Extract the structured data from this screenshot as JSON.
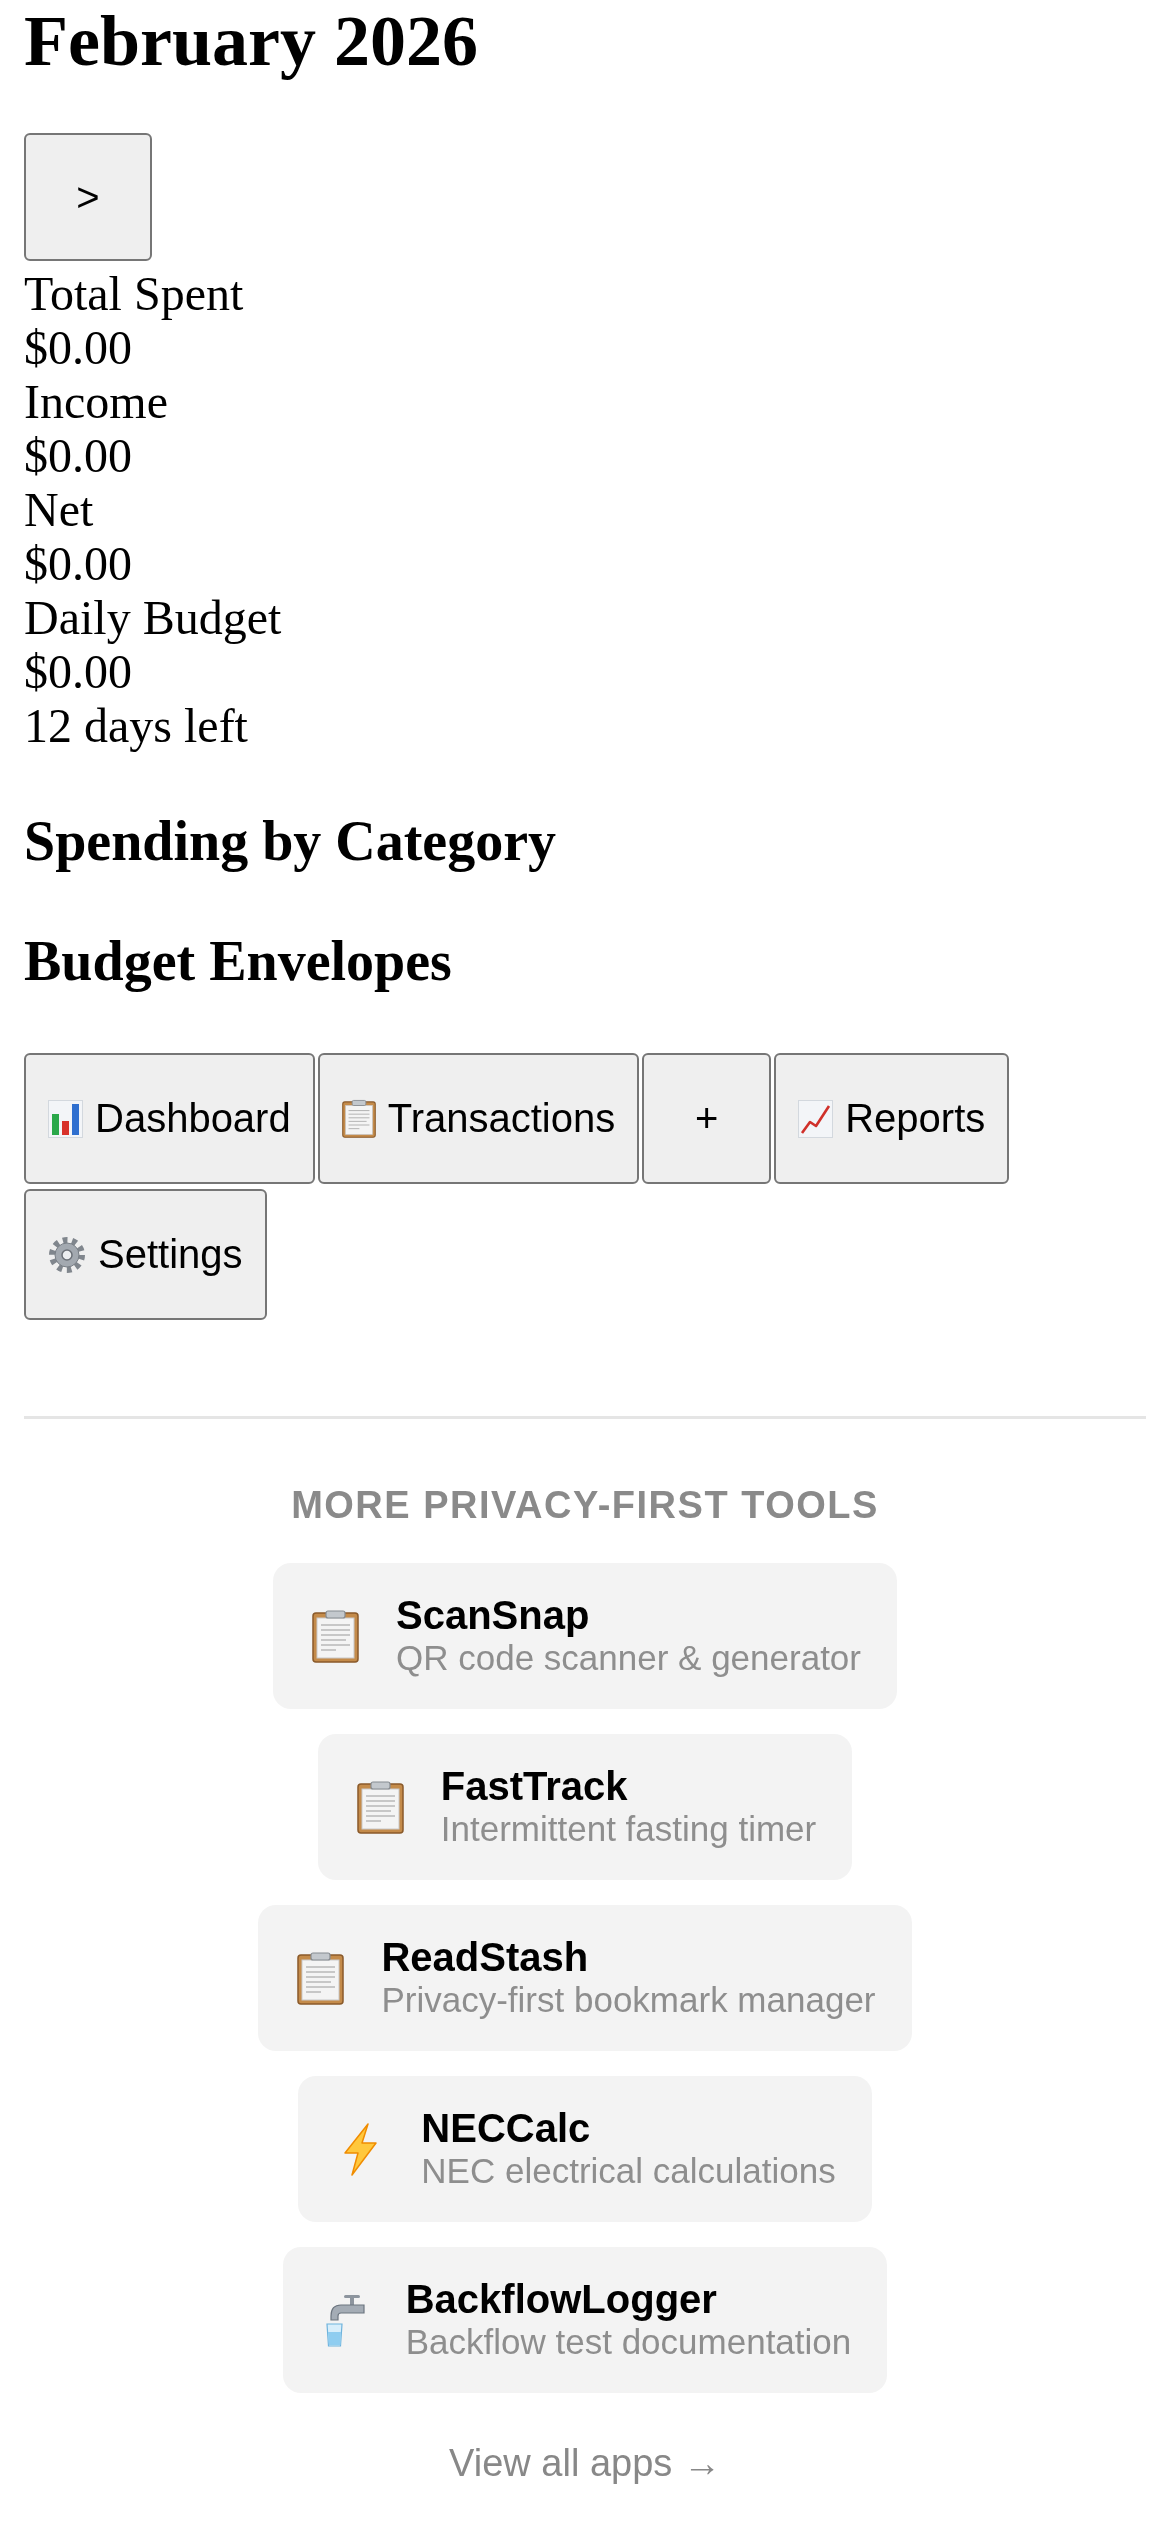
{
  "header": {
    "title": "February 2026",
    "next_button": ">"
  },
  "summary": [
    {
      "label": "Total Spent",
      "value": "$0.00"
    },
    {
      "label": "Income",
      "value": "$0.00"
    },
    {
      "label": "Net",
      "value": "$0.00"
    },
    {
      "label": "Daily Budget",
      "value": "$0.00",
      "note": "12 days left"
    }
  ],
  "sections": [
    {
      "heading": "Spending by Category"
    },
    {
      "heading": "Budget Envelopes"
    }
  ],
  "nav": [
    {
      "kind": "chart",
      "label": "Dashboard"
    },
    {
      "kind": "clipboard",
      "label": "Transactions"
    },
    {
      "kind": "plain",
      "label": "+"
    },
    {
      "kind": "trend",
      "label": "Reports"
    },
    {
      "kind": "gear",
      "label": "Settings"
    }
  ],
  "promo": {
    "heading": "MORE PRIVACY-FIRST TOOLS",
    "apps": [
      {
        "kind": "clipboard",
        "name": "ScanSnap",
        "description": "QR code scanner & generator"
      },
      {
        "kind": "clipboard",
        "name": "FastTrack",
        "description": "Intermittent fasting timer"
      },
      {
        "kind": "clipboard",
        "name": "ReadStash",
        "description": "Privacy-first bookmark manager"
      },
      {
        "kind": "bolt",
        "name": "NECCalc",
        "description": "NEC electrical calculations"
      },
      {
        "kind": "faucet",
        "name": "BackflowLogger",
        "description": "Backflow test documentation"
      }
    ],
    "link": "View all apps →"
  }
}
